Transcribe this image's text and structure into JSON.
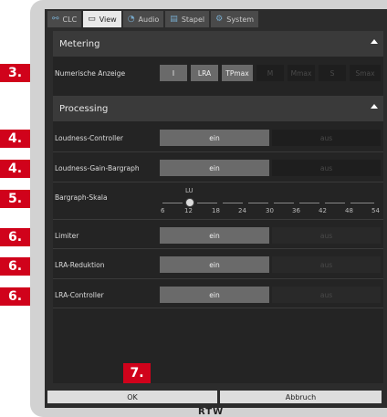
{
  "tabs": [
    {
      "label": "CLC",
      "icon": "network-icon",
      "active": false
    },
    {
      "label": "View",
      "icon": "monitor-icon",
      "active": true
    },
    {
      "label": "Audio",
      "icon": "audio-icon",
      "active": false
    },
    {
      "label": "Stapel",
      "icon": "stack-icon",
      "active": false
    },
    {
      "label": "System",
      "icon": "gear-icon",
      "active": false
    }
  ],
  "metering": {
    "title": "Metering",
    "numeric_label": "Numerische Anzeige",
    "buttons": [
      {
        "label": "I",
        "state": "on"
      },
      {
        "label": "LRA",
        "state": "on"
      },
      {
        "label": "TPmax",
        "state": "on"
      },
      {
        "label": "M",
        "state": "off"
      },
      {
        "label": "Mmax",
        "state": "off"
      },
      {
        "label": "S",
        "state": "off"
      },
      {
        "label": "Smax",
        "state": "off"
      }
    ]
  },
  "processing": {
    "title": "Processing",
    "rows": [
      {
        "label": "Loudness-Controller",
        "on": "ein",
        "off": "aus"
      },
      {
        "label": "Loudness-Gain-Bargraph",
        "on": "ein",
        "off": "aus"
      },
      {
        "label": "Limiter",
        "on": "ein",
        "off": "aus"
      },
      {
        "label": "LRA-Reduktion",
        "on": "ein",
        "off": "aus"
      },
      {
        "label": "LRA-Controller",
        "on": "ein",
        "off": "aus"
      }
    ],
    "bargraph": {
      "label": "Bargraph-Skala",
      "unit": "LU",
      "ticks": [
        "6",
        "12",
        "18",
        "24",
        "30",
        "36",
        "42",
        "48",
        "54"
      ],
      "value": "12"
    }
  },
  "callouts": [
    "3.",
    "4.",
    "4.",
    "5.",
    "6.",
    "6.",
    "6.",
    "7."
  ],
  "footer": {
    "ok": "OK",
    "cancel": "Abbruch",
    "logo": "RTW"
  },
  "colors": {
    "callout": "#d0021b",
    "active": "#6a6a6a",
    "inactive": "#1e1e1e"
  }
}
